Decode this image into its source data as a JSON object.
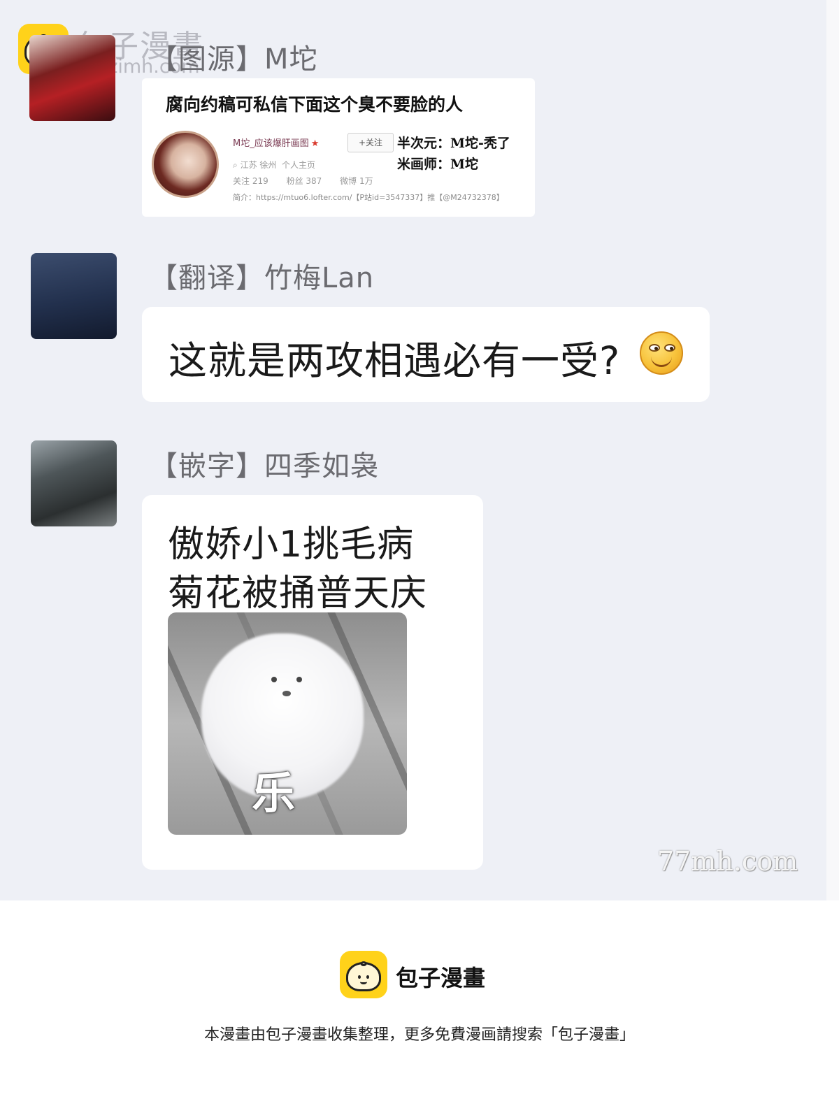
{
  "watermark": {
    "site_name": "包子漫畫",
    "site_url": "baozimh.com",
    "corner": "77mh.com"
  },
  "messages": [
    {
      "label": "【图源】M坨"
    },
    {
      "label": "【翻译】竹梅Lan",
      "text": "这就是两攻相遇必有一受?",
      "emoji": "smirk-emoji"
    },
    {
      "label": "【嵌字】四季如袅",
      "lines": [
        "傲娇小1挑毛病",
        "菊花被捅普天庆"
      ],
      "sticker_caption": "乐"
    }
  ],
  "profile_card": {
    "headline": "腐向约稿可私信下面这个臭不要脸的人",
    "username": "M坨_应该爆肝画图",
    "follow_button": "+关注",
    "location": "江苏 徐州",
    "home": "个人主页",
    "following": "关注 219",
    "fans": "粉丝 387",
    "weibo": "微博 1万",
    "intro": "简介：https://mtuo6.lofter.com/【P站id=3547337】推【@M24732378】",
    "meta_line1": "半次元：M坨-秃了",
    "meta_line2": "米画师：M坨"
  },
  "footer": {
    "brand": "包子漫畫",
    "notice": "本漫畫由包子漫畫收集整理，更多免費漫画請搜索「包子漫畫」"
  },
  "colors": {
    "background": "#eef0f6",
    "bubble": "#ffffff",
    "logo": "#ffd21a"
  }
}
